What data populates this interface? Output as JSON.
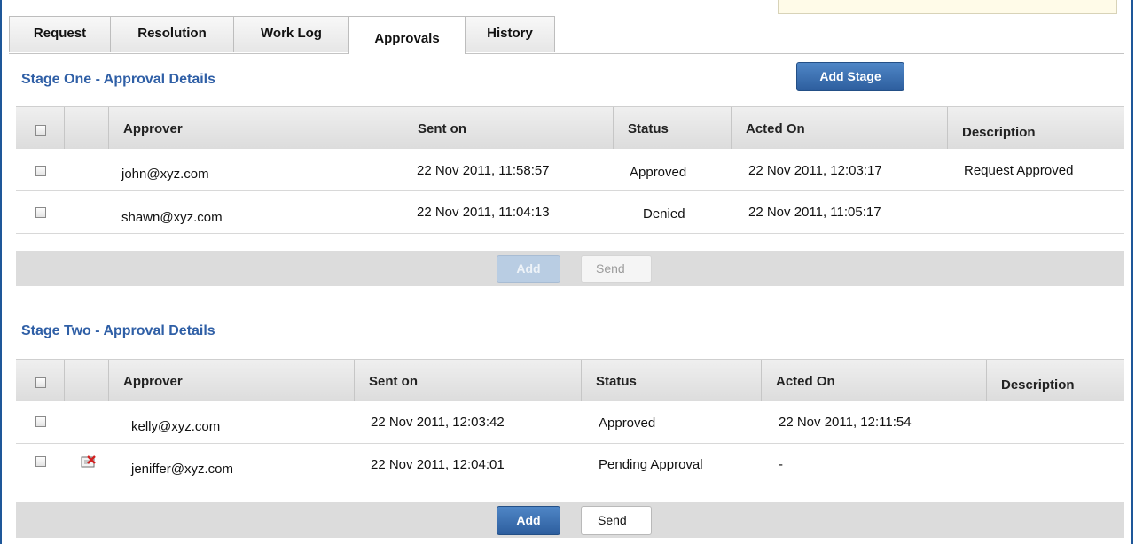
{
  "tabs": [
    "Request",
    "Resolution",
    "Work Log",
    "Approvals",
    "History"
  ],
  "active_tab": "Approvals",
  "add_stage_label": "Add Stage",
  "stage_one": {
    "title": "Stage One - Approval Details",
    "columns": [
      "Approver",
      "Sent on",
      "Status",
      "Acted On",
      "Description"
    ],
    "rows": [
      {
        "approver": "john@xyz.com",
        "sent_on": "22 Nov 2011, 11:58:57",
        "status": "Approved",
        "acted_on": "22 Nov 2011, 12:03:17",
        "description": "Request Approved"
      },
      {
        "approver": "shawn@xyz.com",
        "sent_on": "22 Nov 2011, 11:04:13",
        "status": "Denied",
        "acted_on": "22 Nov 2011, 11:05:17",
        "description": ""
      }
    ],
    "add_label": "Add",
    "send_label": "Send"
  },
  "stage_two": {
    "title": "Stage Two - Approval Details",
    "columns": [
      "Approver",
      "Sent on",
      "Status",
      "Acted On",
      "Description"
    ],
    "rows": [
      {
        "approver": "kelly@xyz.com",
        "sent_on": "22 Nov 2011, 12:03:42",
        "status": "Approved",
        "acted_on": "22 Nov 2011, 12:11:54",
        "description": ""
      },
      {
        "approver": "jeniffer@xyz.com",
        "sent_on": "22 Nov 2011, 12:04:01",
        "status": "Pending Approval",
        "acted_on": "-",
        "description": ""
      }
    ],
    "add_label": "Add",
    "send_label": "Send"
  },
  "icons": {
    "row_delete": "delete-approver-icon"
  },
  "colors": {
    "accent": "#2f5fa6",
    "button": "#2d5e9e"
  }
}
